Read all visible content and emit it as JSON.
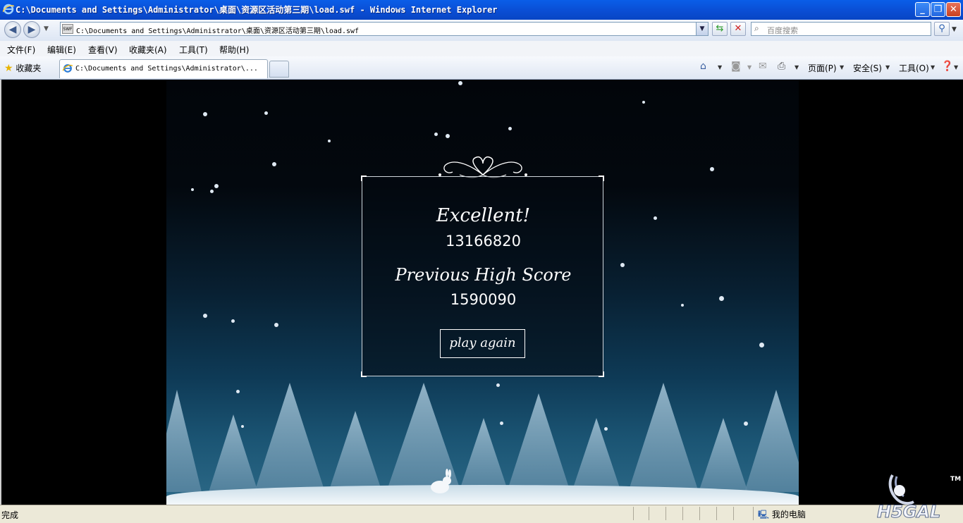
{
  "window": {
    "title": "C:\\Documents and Settings\\Administrator\\桌面\\资源区活动第三期\\load.swf - Windows Internet Explorer",
    "min_label": "_",
    "max_label": "❐",
    "close_label": "✕"
  },
  "address": {
    "url": "C:\\Documents and Settings\\Administrator\\桌面\\资源区活动第三期\\load.swf",
    "page_icon_label": "SWF",
    "search_placeholder": "百度搜索"
  },
  "menu": [
    "文件(F)",
    "编辑(E)",
    "查看(V)",
    "收藏夹(A)",
    "工具(T)",
    "帮助(H)"
  ],
  "tabs": {
    "favorites_label": "收藏夹",
    "active_tab_label": "C:\\Documents and Settings\\Administrator\\..."
  },
  "command_bar": {
    "page_label": "页面(P)",
    "safety_label": "安全(S)",
    "tools_label": "工具(O)"
  },
  "game": {
    "result_title": "Excellent!",
    "score": "13166820",
    "previous_label": "Previous High Score",
    "previous_score": "1590090",
    "play_again_label": "play again"
  },
  "status": {
    "text": "完成",
    "zone": "我的电脑"
  },
  "watermark": {
    "tm": "TM",
    "brand": "H5GAL"
  },
  "colors": {
    "titlebar": "#0a5ee8",
    "panel_border": "#cfd6dc",
    "sky_bottom": "#2d6a88"
  }
}
